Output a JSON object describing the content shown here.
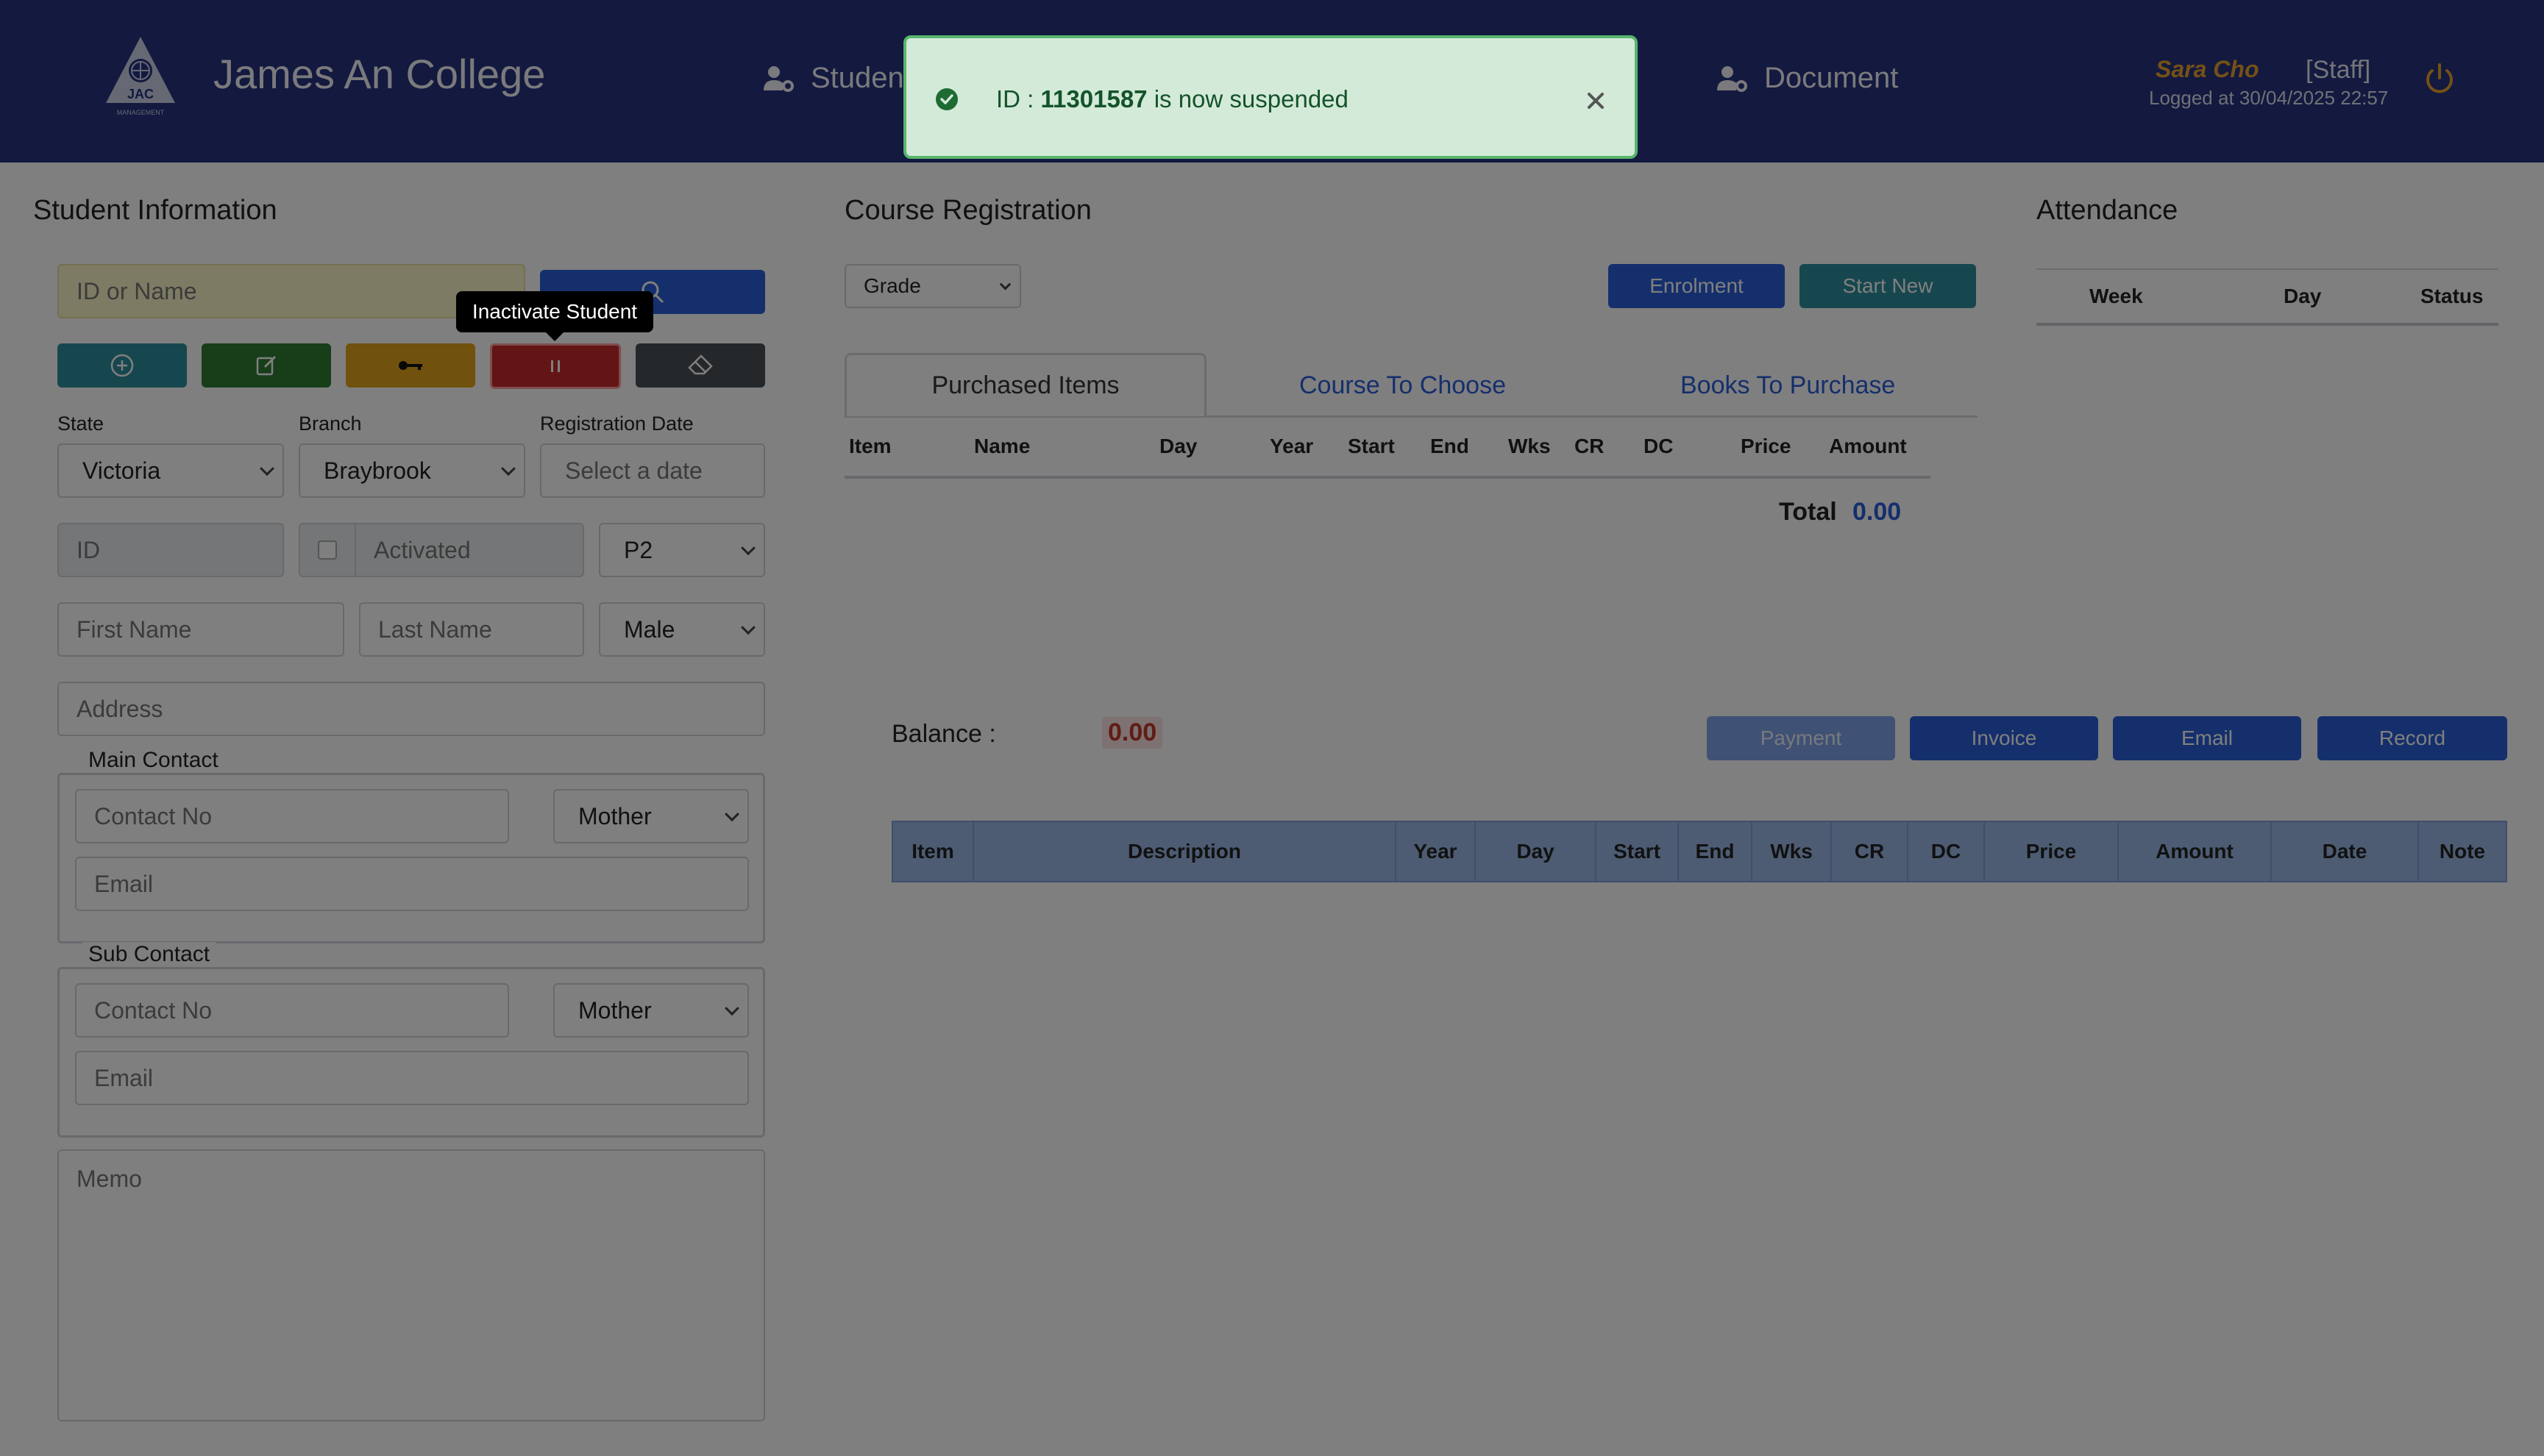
{
  "header": {
    "logo_text": "JAC",
    "logo_subtext": "MANAGEMENT",
    "college_name": "James An College",
    "nav": [
      "Student",
      "Document"
    ],
    "user_name": "Sara Cho",
    "user_role": "[Staff]",
    "logged_at": "Logged at 30/04/2025 22:57"
  },
  "student_info": {
    "title": "Student Information",
    "search_placeholder": "ID or Name",
    "tooltip": "Inactivate Student",
    "state_label": "State",
    "state_value": "Victoria",
    "branch_label": "Branch",
    "branch_value": "Braybrook",
    "reg_date_label": "Registration Date",
    "reg_date_placeholder": "Select a date",
    "id_placeholder": "ID",
    "activated_label": "Activated",
    "grade_value": "P2",
    "first_name_placeholder": "First Name",
    "last_name_placeholder": "Last Name",
    "gender_value": "Male",
    "address_placeholder": "Address",
    "main_contact_legend": "Main Contact",
    "sub_contact_legend": "Sub Contact",
    "contact_placeholder": "Contact No",
    "relation_value": "Mother",
    "email_placeholder": "Email",
    "memo_placeholder": "Memo"
  },
  "course": {
    "title": "Course Registration",
    "grade_select": "Grade",
    "enrolment_label": "Enrolment",
    "start_new_label": "Start New",
    "tabs": [
      "Purchased Items",
      "Course To Choose",
      "Books To Purchase"
    ],
    "columns": [
      "Item",
      "Name",
      "Day",
      "Year",
      "Start",
      "End",
      "Wks",
      "CR",
      "DC",
      "Price",
      "Amount"
    ],
    "total_label": "Total",
    "total_value": "0.00",
    "balance_label": "Balance :",
    "balance_value": "0.00",
    "payment_label": "Payment",
    "invoice_label": "Invoice",
    "email_label": "Email",
    "record_label": "Record",
    "history_columns": [
      "Item",
      "Description",
      "Year",
      "Day",
      "Start",
      "End",
      "Wks",
      "CR",
      "DC",
      "Price",
      "Amount",
      "Date",
      "Note"
    ]
  },
  "attendance": {
    "title": "Attendance",
    "columns": [
      "Week",
      "Day",
      "Status"
    ]
  },
  "toast": {
    "prefix": "ID : ",
    "student_id": "11301587",
    "suffix": " is now suspended"
  },
  "colors": {
    "header_bg": "#27327e",
    "primary_blue": "#2b5fd9",
    "teal": "#2f8f9d",
    "green": "#2e7d32",
    "amber": "#e0a31a",
    "red": "#c62828",
    "dark": "#4a5057",
    "toast_bg": "#d3ead9",
    "toast_border": "#58b56c",
    "balance_red": "#c0392b"
  }
}
